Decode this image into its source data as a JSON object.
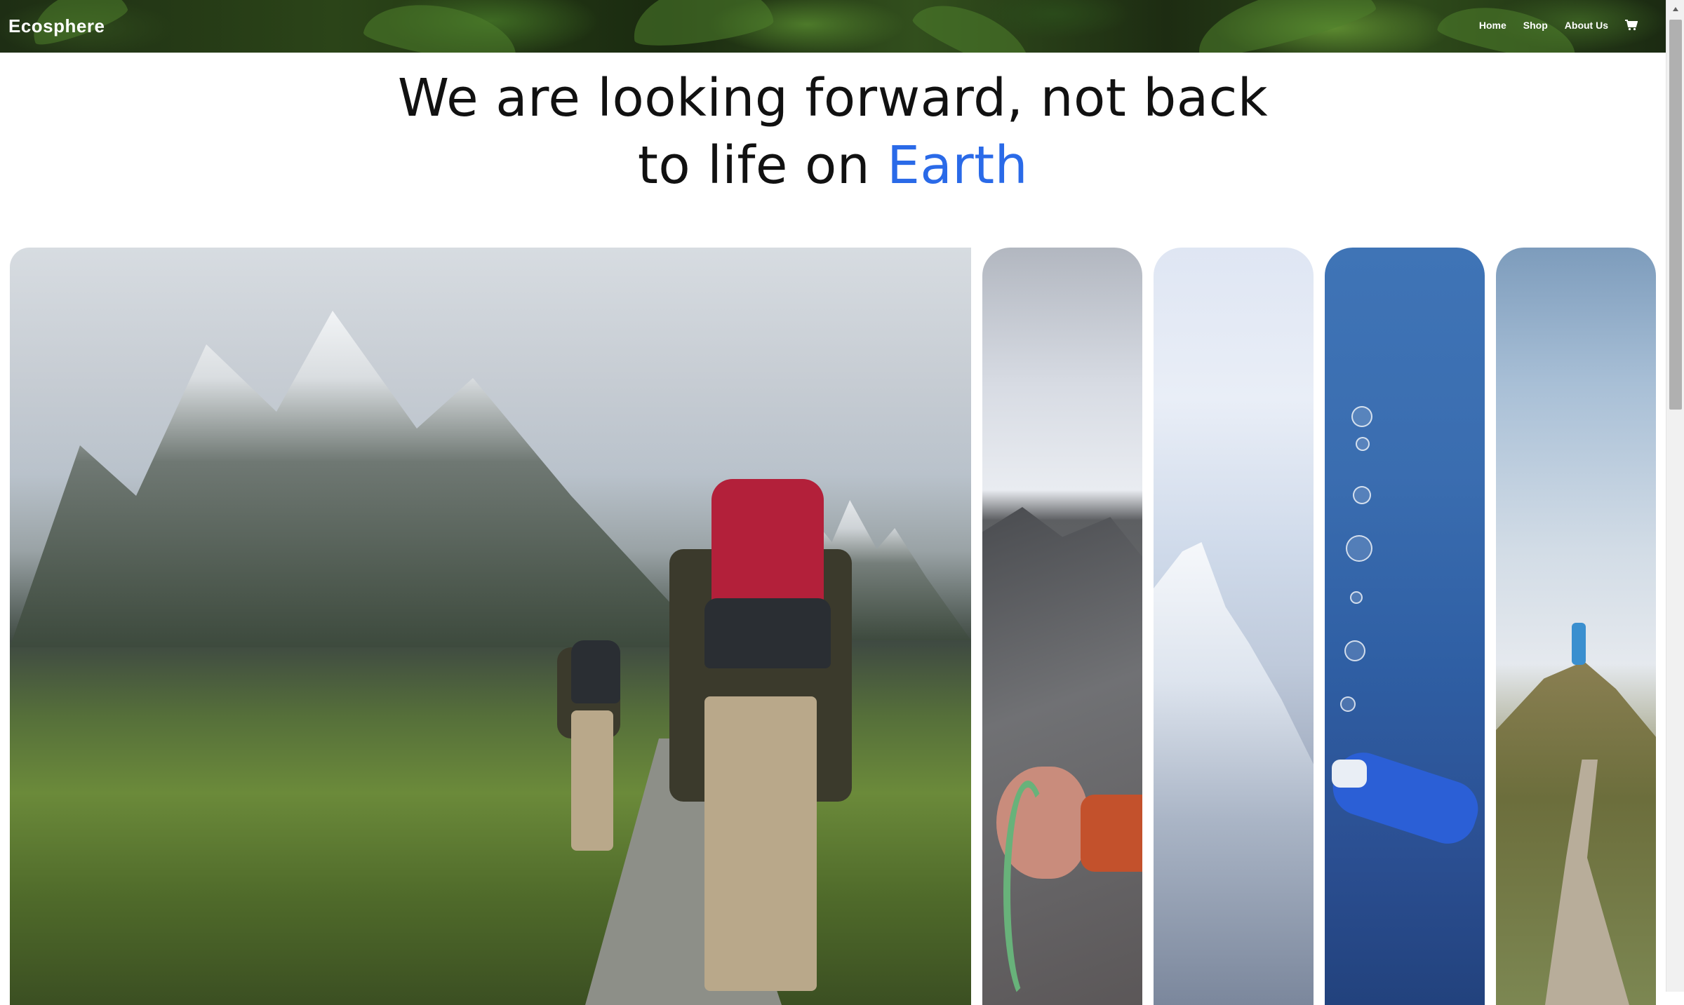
{
  "header": {
    "brand": "Ecosphere",
    "nav": {
      "home": "Home",
      "shop": "Shop",
      "about": "About Us"
    },
    "cart_icon": "cart-icon"
  },
  "hero": {
    "line1": "We are looking forward, not back",
    "line2_prefix": "to life on ",
    "line2_accent": "Earth",
    "accent_color": "#2a6ae8"
  },
  "gallery": {
    "cards": [
      {
        "id": "hiking",
        "icon": "photo"
      },
      {
        "id": "climbing",
        "icon": "photo"
      },
      {
        "id": "mountain",
        "icon": "photo"
      },
      {
        "id": "diving",
        "icon": "photo"
      },
      {
        "id": "summit",
        "icon": "photo"
      }
    ]
  }
}
